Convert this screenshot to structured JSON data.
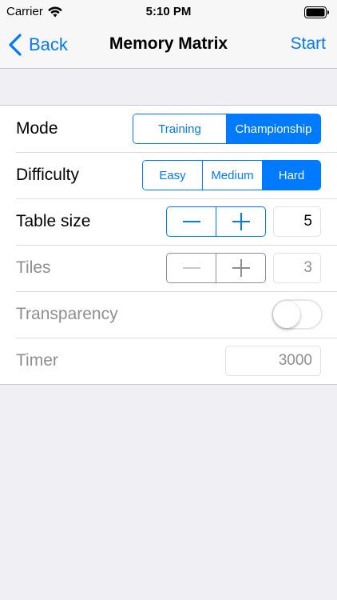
{
  "status_bar": {
    "carrier": "Carrier",
    "time": "5:10 PM",
    "wifi_icon": "wifi-icon",
    "battery_icon": "battery-full-icon"
  },
  "nav": {
    "back_label": "Back",
    "title": "Memory Matrix",
    "start_label": "Start"
  },
  "rows": {
    "mode": {
      "label": "Mode",
      "options": [
        "Training",
        "Championship"
      ],
      "selected": "Championship"
    },
    "difficulty": {
      "label": "Difficulty",
      "options": [
        "Easy",
        "Medium",
        "Hard"
      ],
      "selected": "Hard"
    },
    "table_size": {
      "label": "Table size",
      "value": "5",
      "enabled": true
    },
    "tiles": {
      "label": "Tiles",
      "value": "3",
      "enabled": false
    },
    "transparency": {
      "label": "Transparency",
      "on": false,
      "enabled": false
    },
    "timer": {
      "label": "Timer",
      "value": "3000",
      "enabled": false
    }
  },
  "colors": {
    "accent": "#007aff",
    "disabled": "#8e8e93",
    "background": "#efeff4"
  }
}
